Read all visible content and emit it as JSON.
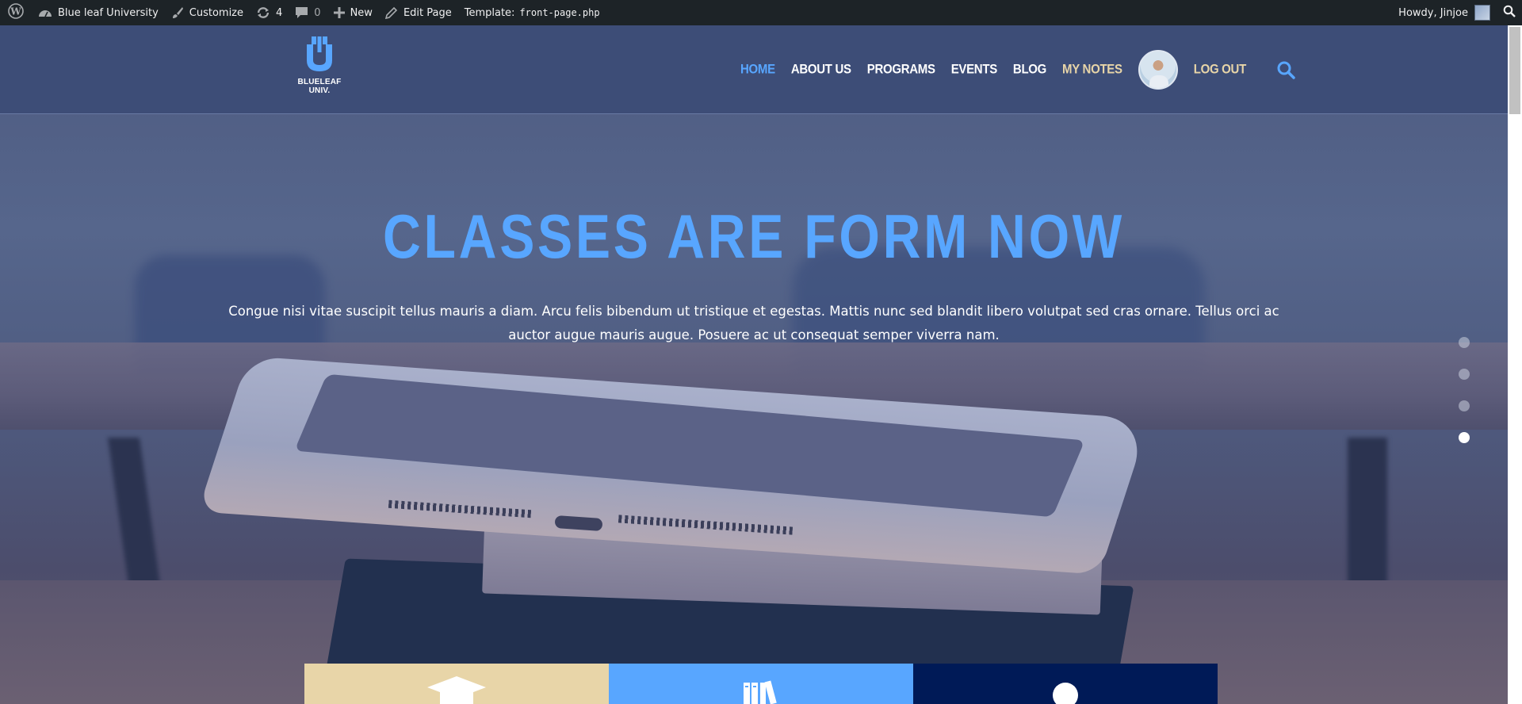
{
  "adminbar": {
    "site_name": "Blue leaf University",
    "customize": "Customize",
    "updates_count": "4",
    "comments_count": "0",
    "new_label": "New",
    "edit_page": "Edit Page",
    "template_label": "Template:",
    "template_file": "front-page.php",
    "howdy": "Howdy, Jinjoe"
  },
  "header": {
    "logo_text": "BLUELEAF UNIV.",
    "nav": [
      "HOME",
      "ABOUT US",
      "PROGRAMS",
      "EVENTS",
      "BLOG",
      "MY NOTES"
    ],
    "logout": "LOG OUT"
  },
  "hero": {
    "title": "CLASSES ARE FORM NOW",
    "text": "Congue nisi vitae suscipit tellus mauris a diam. Arcu felis bibendum ut tristique et egestas. Mattis nunc sed blandit libero volutpat sed cras ornare. Tellus orci ac auctor augue mauris augue. Posuere ac ut consequat semper viverra nam.",
    "slider_active_index": 3,
    "slider_count": 4
  },
  "tiles": [
    {
      "icon": "graduation-cap-icon",
      "color": "#e8d5a8"
    },
    {
      "icon": "books-icon",
      "color": "#58a6ff"
    },
    {
      "icon": "person-icon",
      "color": "#001a57"
    }
  ],
  "colors": {
    "accent_blue": "#58a6ff",
    "gold": "#e8d5a8",
    "navy": "#001a57",
    "adminbar": "#1d2327"
  }
}
